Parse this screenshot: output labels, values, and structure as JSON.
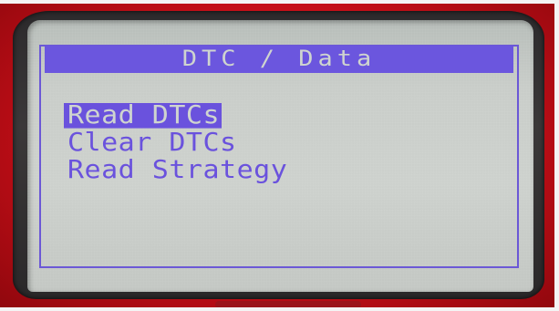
{
  "screen": {
    "title": "DTC / Data",
    "menu": [
      {
        "label": "Read DTCs",
        "selected": true
      },
      {
        "label": "Clear DTCs",
        "selected": false
      },
      {
        "label": "Read Strategy",
        "selected": false
      }
    ]
  },
  "colors": {
    "device_body": "#d01820",
    "lcd_background": "#c9cdc9",
    "lcd_foreground": "#6a52dd"
  }
}
